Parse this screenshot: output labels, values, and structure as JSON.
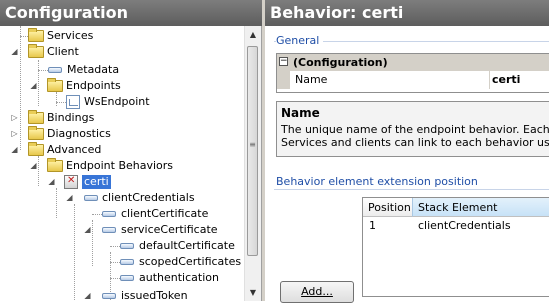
{
  "left": {
    "title": "Configuration",
    "tree": [
      {
        "label": "Services",
        "icon": "folder-icon",
        "expander": "none"
      },
      {
        "label": "Client",
        "icon": "folder-icon",
        "expander": "expanded"
      },
      {
        "label": "Metadata",
        "icon": "item-icon",
        "expander": "none"
      },
      {
        "label": "Endpoints",
        "icon": "folder-icon",
        "expander": "expanded"
      },
      {
        "label": "WsEndpoint",
        "icon": "endpoint-icon",
        "expander": "none"
      },
      {
        "label": "Bindings",
        "icon": "folder-icon",
        "expander": "collapsed"
      },
      {
        "label": "Diagnostics",
        "icon": "folder-icon",
        "expander": "collapsed"
      },
      {
        "label": "Advanced",
        "icon": "folder-icon",
        "expander": "expanded"
      },
      {
        "label": "Endpoint Behaviors",
        "icon": "folder-icon",
        "expander": "expanded"
      },
      {
        "label": "certi",
        "icon": "behavior-icon",
        "expander": "expanded",
        "selected": true
      },
      {
        "label": "clientCredentials",
        "icon": "item-icon",
        "expander": "expanded"
      },
      {
        "label": "clientCertificate",
        "icon": "item-icon",
        "expander": "none"
      },
      {
        "label": "serviceCertificate",
        "icon": "item-icon",
        "expander": "expanded"
      },
      {
        "label": "defaultCertificate",
        "icon": "item-icon",
        "expander": "none"
      },
      {
        "label": "scopedCertificates",
        "icon": "item-icon",
        "expander": "none"
      },
      {
        "label": "authentication",
        "icon": "item-icon",
        "expander": "none"
      },
      {
        "label": "issuedToken",
        "icon": "item-icon",
        "expander": "expanded"
      }
    ],
    "scrollbar": {
      "up": "▲",
      "down": "▼",
      "grip": "≡"
    }
  },
  "right": {
    "title": "Behavior: certi",
    "general_label": "General",
    "property_grid": {
      "collapse_glyph": "⊟",
      "category": "(Configuration)",
      "name_label": "Name",
      "name_value": "certi"
    },
    "help": {
      "title": "Name",
      "line1": "The unique name of the endpoint behavior. Each behav",
      "line2": "Services and clients can link to each behavior using ti"
    },
    "extension_label": "Behavior element extension position",
    "grid": {
      "headers": [
        "Position",
        "Stack Element"
      ],
      "rows": [
        {
          "position": "1",
          "element": "clientCredentials"
        }
      ]
    },
    "add_label": "Add...",
    "add_hotkey": "A"
  },
  "colors": {
    "title_bar": "#6a6a6a",
    "accent": "#1f4ea6",
    "selection": "#3875d7"
  }
}
